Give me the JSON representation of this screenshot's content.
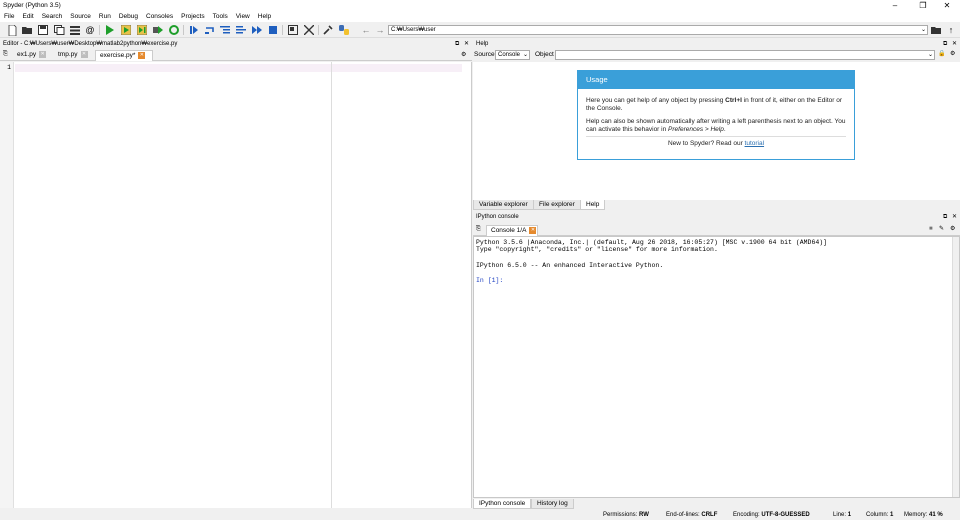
{
  "window": {
    "title": "Spyder (Python 3.5)",
    "minimize": "–",
    "restore": "❐",
    "close": "✕"
  },
  "menu": [
    "File",
    "Edit",
    "Search",
    "Source",
    "Run",
    "Debug",
    "Consoles",
    "Projects",
    "Tools",
    "View",
    "Help"
  ],
  "toolbar": {
    "path": "C:₩Users₩user",
    "icons": [
      "new-file-icon",
      "open-file-icon",
      "save-icon",
      "save-all-icon",
      "file-list-icon",
      "at-icon",
      "run-icon",
      "run-cell-icon",
      "run-cell-advance-icon",
      "run-selection-icon",
      "rerun-icon",
      "debug-icon",
      "step-icon",
      "step-into-icon",
      "step-return-icon",
      "continue-icon",
      "stop-icon",
      "maximize-pane-icon",
      "fullscreen-icon",
      "preferences-icon",
      "python-path-icon",
      "back-arrow-icon",
      "forward-arrow-icon",
      "browse-folder-icon",
      "parent-dir-icon"
    ],
    "colors": {
      "run": "#1e9e2a",
      "debug": "#1f5fbf",
      "stop": "#1f5fbf"
    }
  },
  "editor": {
    "header": "Editor - C:₩Users₩user₩Desktop₩matlab2python₩exercise.py",
    "tabs": [
      {
        "label": "ex1.py",
        "active": false
      },
      {
        "label": "tmp.py",
        "active": false
      },
      {
        "label": "exercise.py*",
        "active": true
      }
    ],
    "line_numbers": [
      "1"
    ]
  },
  "help": {
    "header": "Help",
    "source_label": "Source",
    "source_value": "Console",
    "object_label": "Object",
    "object_value": "",
    "usage_title": "Usage",
    "usage_p1_a": "Here you can get help of any object by pressing ",
    "usage_p1_key": "Ctrl+I",
    "usage_p1_b": " in front of it, either on the Editor or the Console.",
    "usage_p2_a": "Help can also be shown automatically after writing a left parenthesis next to an object. You can activate this behavior in ",
    "usage_p2_em": "Preferences > Help",
    "usage_p2_b": ".",
    "usage_foot_a": "New to Spyder? Read our ",
    "usage_foot_link": "tutorial",
    "bottom_tabs": [
      "Variable explorer",
      "File explorer",
      "Help"
    ]
  },
  "console": {
    "header": "IPython console",
    "tab": "Console 1/A",
    "lines": [
      "Python 3.5.6 |Anaconda, Inc.| (default, Aug 26 2018, 16:05:27) [MSC v.1900 64 bit (AMD64)]",
      "Type \"copyright\", \"credits\" or \"license\" for more information.",
      "",
      "IPython 6.5.0 -- An enhanced Interactive Python.",
      "",
      "In [1]:"
    ],
    "bottom_tabs": [
      "IPython console",
      "History log"
    ]
  },
  "status": {
    "permissions_label": "Permissions:",
    "permissions": "RW",
    "eol_label": "End-of-lines:",
    "eol": "CRLF",
    "encoding_label": "Encoding:",
    "encoding": "UTF-8-GUESSED",
    "line_label": "Line:",
    "line": "1",
    "column_label": "Column:",
    "column": "1",
    "memory_label": "Memory:",
    "memory": "41 %"
  }
}
